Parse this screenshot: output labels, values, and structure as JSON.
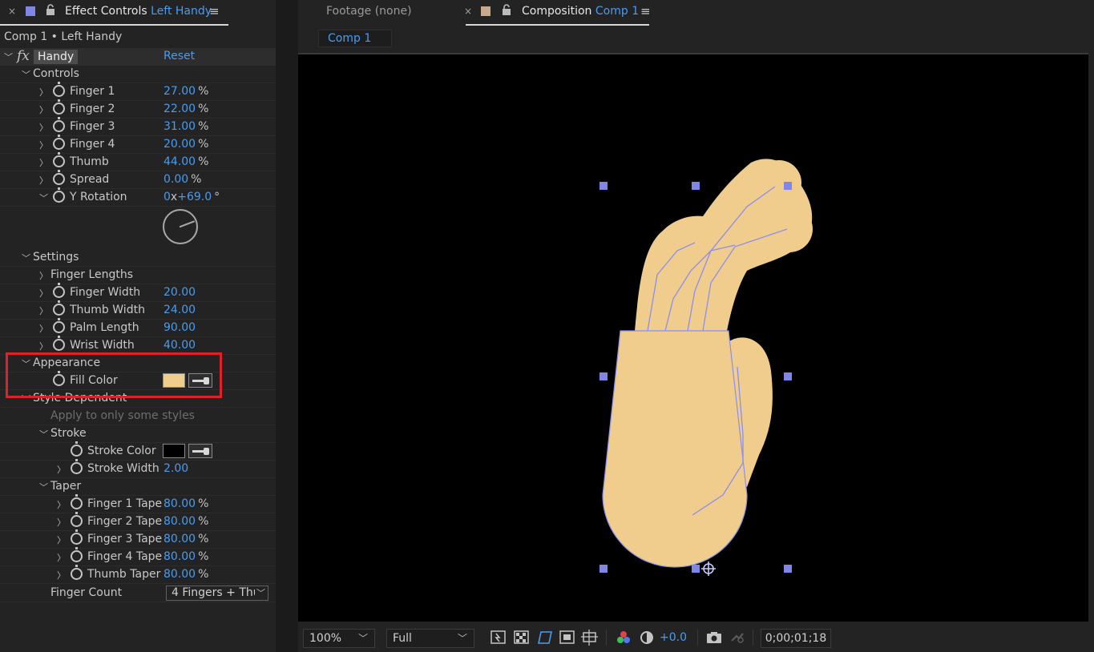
{
  "left_panel": {
    "tab_close": "×",
    "tab_title": "Effect Controls",
    "tab_layer": "Left Handy",
    "tab_menu": "≡",
    "layer_path": "Comp 1 • Left Handy",
    "effect": {
      "fx_mark": "fx",
      "name": "Handy",
      "reset": "Reset"
    },
    "controls": {
      "label": "Controls",
      "params": [
        {
          "label": "Finger 1",
          "value": "27.00",
          "unit": "%"
        },
        {
          "label": "Finger 2",
          "value": "22.00",
          "unit": "%"
        },
        {
          "label": "Finger 3",
          "value": "31.00",
          "unit": "%"
        },
        {
          "label": "Finger 4",
          "value": "20.00",
          "unit": "%"
        },
        {
          "label": "Thumb",
          "value": "44.00",
          "unit": "%"
        },
        {
          "label": "Spread",
          "value": "0.00",
          "unit": "%"
        }
      ],
      "y_rotation": {
        "label": "Y Rotation",
        "revolutions": "0",
        "x": "x",
        "degrees": "+69.0",
        "deg_unit": "°"
      }
    },
    "settings": {
      "label": "Settings",
      "finger_lengths": "Finger Lengths",
      "params": [
        {
          "label": "Finger Width",
          "value": "20.00"
        },
        {
          "label": "Thumb Width",
          "value": "24.00"
        },
        {
          "label": "Palm Length",
          "value": "90.00"
        },
        {
          "label": "Wrist Width",
          "value": "40.00"
        }
      ]
    },
    "appearance": {
      "label": "Appearance",
      "fill_color_label": "Fill Color",
      "fill_color": "#f0cd8c"
    },
    "style_dependent": {
      "label": "Style Dependent",
      "note": "Apply to only some styles",
      "stroke": {
        "label": "Stroke",
        "color_label": "Stroke Color",
        "color": "#000000",
        "width_label": "Stroke Width",
        "width_value": "2.00"
      },
      "taper": {
        "label": "Taper",
        "params": [
          {
            "label": "Finger 1 Tape",
            "value": "80.00",
            "unit": "%"
          },
          {
            "label": "Finger 2 Tape",
            "value": "80.00",
            "unit": "%"
          },
          {
            "label": "Finger 3 Tape",
            "value": "80.00",
            "unit": "%"
          },
          {
            "label": "Finger 4 Tape",
            "value": "80.00",
            "unit": "%"
          },
          {
            "label": "Thumb Taper",
            "value": "80.00",
            "unit": "%"
          }
        ]
      }
    },
    "finger_count": {
      "label": "Finger Count",
      "selected": "4 Fingers + Thu"
    }
  },
  "right_panel": {
    "footage_tab": "Footage (none)",
    "composition_tab": {
      "close": "×",
      "title": "Composition",
      "name": "Comp 1",
      "menu": "≡"
    },
    "comp_subtab": "Comp 1",
    "bottom_bar": {
      "zoom": "100%",
      "resolution": "Full",
      "exposure": "+0.0",
      "timecode": "0;00;01;18"
    }
  },
  "colors": {
    "accent": "#4a9cf0",
    "panel_bg": "#232323",
    "hand_fill": "#f0cd8c",
    "wireframe": "#8a8ef0",
    "highlight": "#e0202b"
  },
  "icons": [
    "close-icon",
    "effect-swatch-icon",
    "lock-icon",
    "panel-menu-icon",
    "twirl-chevron-icon",
    "stopwatch-icon",
    "eyedropper-icon",
    "dropdown-chevron-icon",
    "snapshot-icon",
    "transparency-grid-icon",
    "mask-visibility-icon",
    "guides-icon",
    "color-channels-icon",
    "reset-exposure-icon"
  ]
}
